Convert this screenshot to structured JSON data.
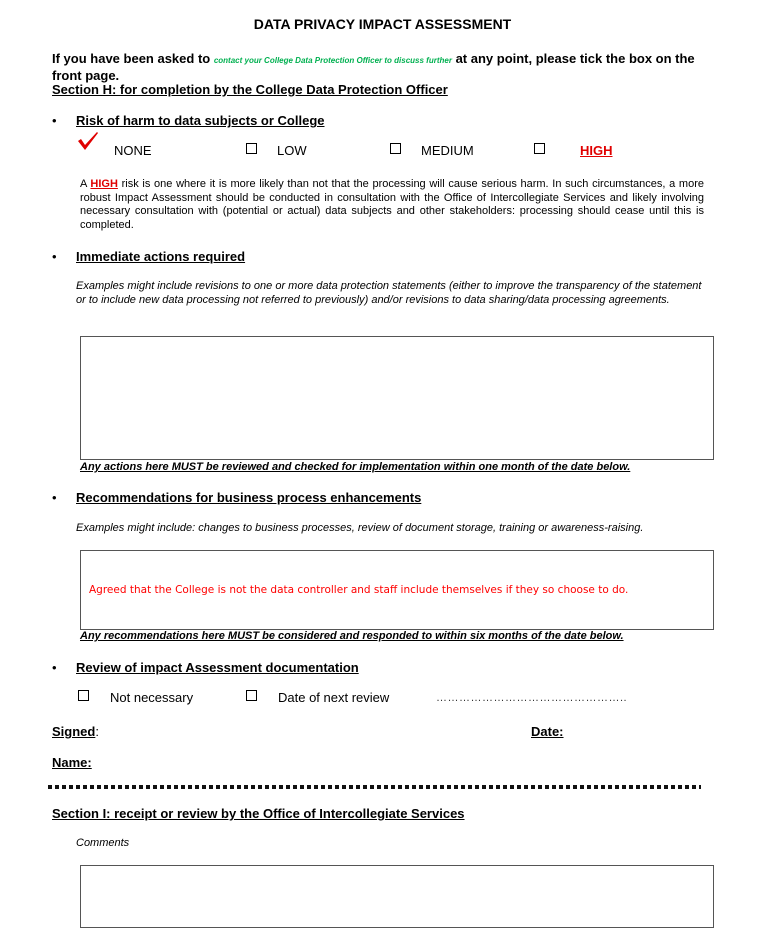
{
  "document": {
    "title": "DATA PRIVACY IMPACT ASSESSMENT",
    "intro": {
      "prefix": "If you have been asked to ",
      "highlight": "contact your College Data Protection Officer to discuss further",
      "suffix": " at any point, please tick the box on the front page.",
      "highlight_color": "#00b050"
    },
    "section_h_heading": "Section H: for completion by the College Data Protection Officer",
    "risk": {
      "heading": "Risk of harm to data subjects or College",
      "options": [
        {
          "label": "NONE",
          "checked": true
        },
        {
          "label": "LOW",
          "checked": false
        },
        {
          "label": "MEDIUM",
          "checked": false
        },
        {
          "label": "HIGH",
          "checked": false
        }
      ],
      "explanation_prefix": "A ",
      "explanation_high": "HIGH",
      "explanation_rest": " risk is one where it is more likely than not that the processing will cause serious harm.  In such circumstances, a more robust Impact Assessment should be conducted in consultation with the Office of Intercollegiate Services and likely involving necessary consultation with (potential or actual) data subjects and other stakeholders: processing should cease until this is completed.",
      "check_color": "#e00000",
      "high_color": "#e00000"
    },
    "immediate_actions": {
      "heading": "Immediate actions required",
      "examples": "Examples might include revisions to one or more data protection statements (either to improve the transparency of the statement or to include new data processing not referred to previously) and/or revisions to data sharing/data processing agreements.",
      "value": "",
      "note": "Any actions here MUST be reviewed and checked for implementation within one month of the date below."
    },
    "recommendations": {
      "heading": "Recommendations for business process enhancements",
      "examples": "Examples might include: changes to business processes, review of document storage, training or awareness-raising.",
      "value": "Agreed that the College is not the data controller and staff include themselves if they so choose to do.",
      "note": "Any recommendations here MUST be considered and responded to within six months of the date below."
    },
    "review": {
      "heading": "Review of impact Assessment documentation",
      "options": [
        {
          "label": "Not necessary",
          "checked": false
        },
        {
          "label": "Date of next review",
          "checked": false
        }
      ],
      "date_placeholder": "………………………………………….."
    },
    "signature": {
      "signed_label": "Signed",
      "signed_colon": ":",
      "date_label": "Date:",
      "name_label": "Name:"
    },
    "section_i": {
      "heading": "Section I: receipt or review by the Office of Intercollegiate Services",
      "comments_label": "Comments",
      "comments_value": ""
    },
    "bullet": "•"
  }
}
